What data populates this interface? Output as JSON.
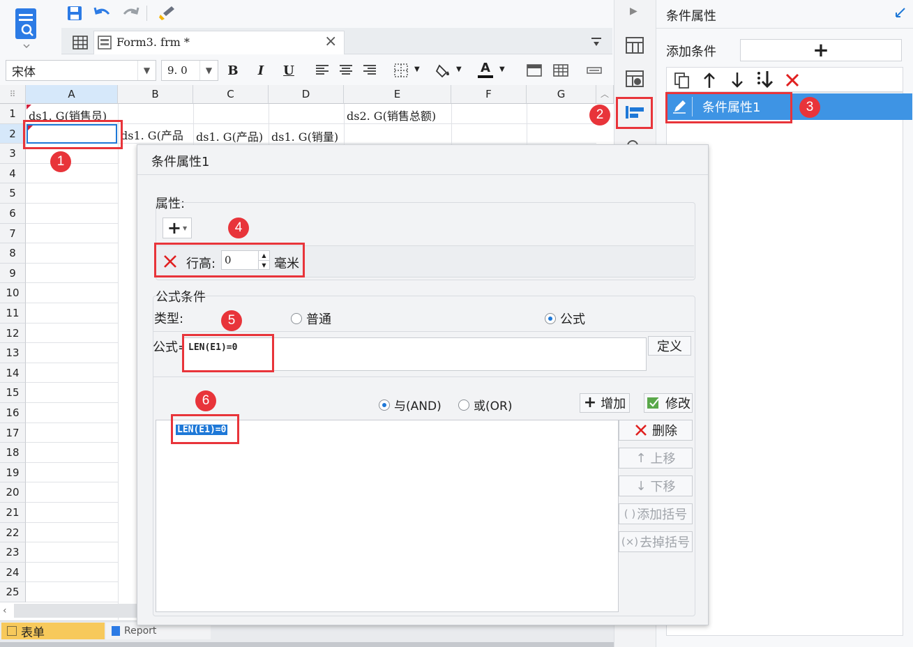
{
  "file_tab": {
    "name": "Form3. frm *",
    "close": "×"
  },
  "font": {
    "family": "宋体",
    "size": "9. 0"
  },
  "format_buttons": {
    "bold": "B",
    "italic": "I",
    "underline": "U",
    "font_color": "A"
  },
  "grid": {
    "columns": [
      "A",
      "B",
      "C",
      "D",
      "E",
      "F",
      "G"
    ],
    "rows": [
      "1",
      "2",
      "3",
      "4",
      "5",
      "6",
      "7",
      "8",
      "9",
      "10",
      "11",
      "12",
      "13",
      "14",
      "15",
      "16",
      "17",
      "18",
      "19",
      "20",
      "21",
      "22",
      "23",
      "24",
      "25"
    ],
    "cells": {
      "A1": "ds1. G(销售员)",
      "E1": "ds2. G(销售总额)",
      "B2": "ds1. G(产品",
      "C2": "ds1. G(产品)",
      "D2": "ds1. G(销量)"
    }
  },
  "bottom": {
    "sheet_tab": "表单",
    "report_tab": "Report"
  },
  "right_panel": {
    "title": "条件属性",
    "add_condition_label": "添加条件",
    "add_symbol": "+",
    "condition_item": "条件属性1"
  },
  "dialog": {
    "title": "条件属性1",
    "property_section": "属性:",
    "row_height_label": "行高:",
    "row_height_value": "0",
    "row_height_unit": "毫米",
    "formula_section": "公式条件",
    "type_label": "类型:",
    "type_normal": "普通",
    "type_formula": "公式",
    "formula_label": "公式=",
    "formula_value": "LEN(E1)=0",
    "define_button": "定义",
    "and_label": "与(AND)",
    "or_label": "或(OR)",
    "add_button": "增加",
    "modify_button": "修改",
    "delete_button": "删除",
    "up_button": "上移",
    "down_button": "下移",
    "add_bracket_button": "添加括号",
    "remove_bracket_button": "去掉括号",
    "condition_list": [
      "LEN(E1)=0"
    ]
  },
  "annotations": [
    "1",
    "2",
    "3",
    "4",
    "5",
    "6"
  ],
  "colors": {
    "accent": "#1e78d7",
    "annotation": "#e8343a",
    "selected_row": "#3e94e4"
  }
}
